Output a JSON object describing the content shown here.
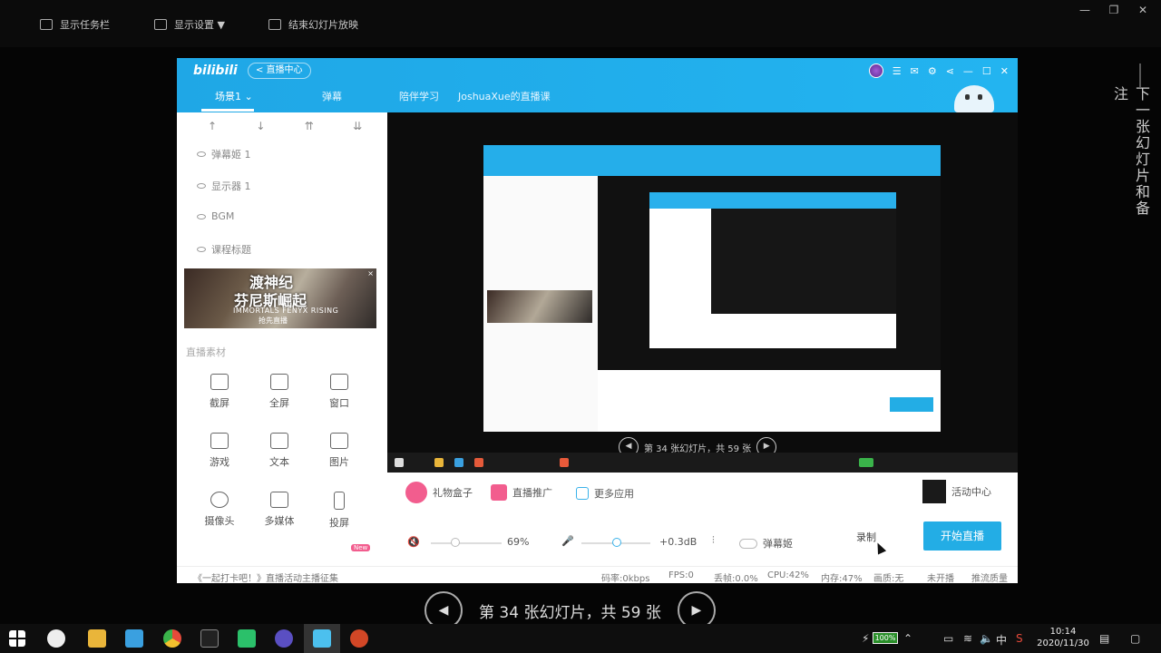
{
  "presenter_toolbar": {
    "items": [
      {
        "label": "显示任务栏",
        "icon": "taskbar-icon"
      },
      {
        "label": "显示设置 ▼",
        "icon": "display-settings-icon"
      },
      {
        "label": "结束幻灯片放映",
        "icon": "end-slideshow-icon"
      }
    ]
  },
  "side_label": "下一张幻灯片和备注",
  "app": {
    "logo": "bilibili",
    "back_label": "< 直播中心",
    "tabs": [
      {
        "label": "场景1 ⌄",
        "active": true
      },
      {
        "label": "弹幕"
      },
      {
        "label": "陪伴学习"
      },
      {
        "label": "JoshuaXue的直播课"
      }
    ],
    "header_icons": [
      "avatar",
      "menu-icon",
      "mail-icon",
      "settings-icon",
      "share-icon",
      "minimize-icon",
      "maximize-icon",
      "close-icon"
    ],
    "scene_arrows": [
      "↑",
      "↓",
      "⇈",
      "⇊"
    ],
    "scene_items": [
      "弹幕姬 1",
      "显示器 1",
      "BGM",
      "课程标题"
    ],
    "banner": {
      "line1": "渡神纪",
      "line2": "芬尼斯崛起",
      "line3": "IMMORTALS FENYX RISING",
      "line4": "抢先直播",
      "close": "×"
    },
    "materials_title": "直播素材",
    "materials": [
      {
        "label": "截屏",
        "icon": "crop-icon"
      },
      {
        "label": "全屏",
        "icon": "monitor-icon"
      },
      {
        "label": "窗口",
        "icon": "window-icon"
      },
      {
        "label": "游戏",
        "icon": "gamepad-icon"
      },
      {
        "label": "文本",
        "icon": "text-icon"
      },
      {
        "label": "图片",
        "icon": "image-icon"
      },
      {
        "label": "摄像头",
        "icon": "camera-icon"
      },
      {
        "label": "多媒体",
        "icon": "media-icon"
      },
      {
        "label": "投屏",
        "icon": "phone-icon"
      }
    ],
    "new_tag": "New",
    "preview_nav": {
      "prev": "◀",
      "text": "第 34 张幻灯片，共 59 张",
      "next": "▶"
    },
    "controls": {
      "gift": "礼物盒子",
      "promotion": "直播推广",
      "more_apps": "更多应用",
      "activity": "活动中心",
      "volume_pct": "69%",
      "volume_level": 0.69,
      "mic_db": "+0.3dB",
      "danmaku_toggle": "弹幕姬",
      "record": "录制",
      "start": "开始直播"
    },
    "status": {
      "notice": "《一起打卡吧！》直播活动主播征集",
      "bitrate": "码率:0kbps",
      "fps": "FPS:0",
      "drop": "丢帧:0.0%",
      "cpu": "CPU:42%",
      "mem": "内存:47%",
      "quality": "画质:无",
      "live_state": "未开播",
      "stream_quality": "推流质量"
    }
  },
  "slide_nav": {
    "prev": "◀",
    "text": "第 34 张幻灯片，共 59 张",
    "next": "▶"
  },
  "taskbar": {
    "battery": "100%",
    "ime": "中",
    "time": "10:14",
    "date": "2020/11/30"
  }
}
